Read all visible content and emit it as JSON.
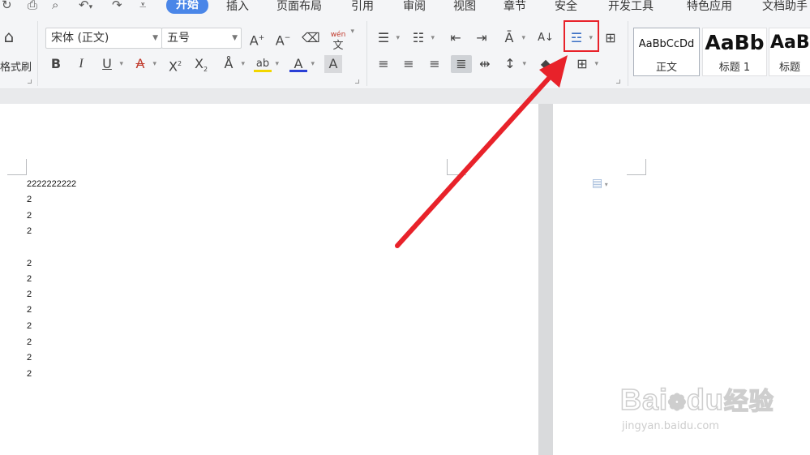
{
  "menu": {
    "items": [
      "开始",
      "插入",
      "页面布局",
      "引用",
      "审阅",
      "视图",
      "章节",
      "安全",
      "开发工具",
      "特色应用",
      "文档助手"
    ]
  },
  "ribbon": {
    "format_painter_label": "格式刷",
    "font_name": "宋体 (正文)",
    "font_size": "五号",
    "phonetic_label": "wén",
    "phonetic_char": "文"
  },
  "styles": [
    {
      "sample": "AaBbCcDd",
      "name": "正文"
    },
    {
      "sample": "AaBb",
      "name": "标题 1"
    },
    {
      "sample": "AaB",
      "name": "标题"
    }
  ],
  "document": {
    "lines": [
      "2222222222",
      "2",
      "2",
      "2",
      "",
      "2",
      "2",
      "2",
      "2",
      "2",
      "2",
      "2",
      "2"
    ]
  },
  "watermark": {
    "brand": "Bai",
    "brand2": "du",
    "brand_cn": "经验",
    "url": "jingyan.baidu.com"
  },
  "colors": {
    "accent": "#4a86e8",
    "annotation": "#e8222a",
    "highlight_yellow": "#f2d600",
    "font_color_red": "#e02020"
  },
  "icons": [
    "undo-icon",
    "redo-icon",
    "print-icon",
    "print-preview-icon",
    "customize-icon",
    "format-painter-icon",
    "grow-font-icon",
    "shrink-font-icon",
    "clear-format-icon",
    "phonetic-guide-icon",
    "bold-icon",
    "italic-icon",
    "underline-icon",
    "strikethrough-icon",
    "superscript-icon",
    "subscript-icon",
    "text-effect-icon",
    "highlight-icon",
    "font-color-icon",
    "char-shading-icon",
    "bullets-icon",
    "numbering-icon",
    "decrease-indent-icon",
    "increase-indent-icon",
    "chinese-layout-icon",
    "sort-icon",
    "paragraph-spacing-icon",
    "table-insert-icon",
    "align-left-icon",
    "align-center-icon",
    "align-right-icon",
    "justify-icon",
    "distribute-icon",
    "line-spacing-icon",
    "borders-icon",
    "paste-options-icon",
    "annotation-arrow"
  ]
}
